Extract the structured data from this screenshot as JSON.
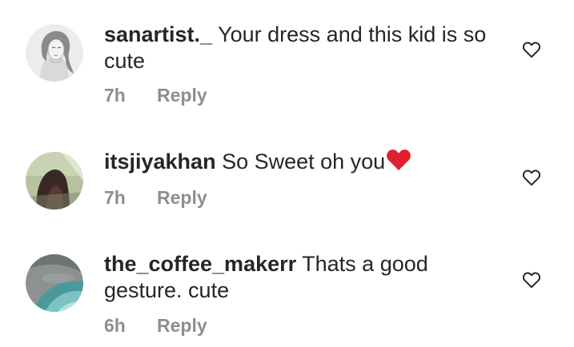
{
  "comments": [
    {
      "username": "sanartist._",
      "text": " Your dress and this kid is so cute",
      "time": "7h",
      "reply_label": "Reply",
      "avatar_icon": "portrait-sketch-avatar"
    },
    {
      "username": "itsjiyakhan",
      "text": " So Sweet oh you",
      "emoji": "❤",
      "time": "7h",
      "reply_label": "Reply",
      "avatar_icon": "photo-avatar"
    },
    {
      "username": "the_coffee_makerr",
      "text": " Thats a good gesture. cute",
      "time": "6h",
      "reply_label": "Reply",
      "avatar_icon": "teal-abstract-avatar"
    }
  ],
  "colors": {
    "text": "#262626",
    "meta": "#8e8e8e",
    "heart_emoji": "#e0202e"
  },
  "icons": {
    "like": "heart-outline-icon"
  }
}
